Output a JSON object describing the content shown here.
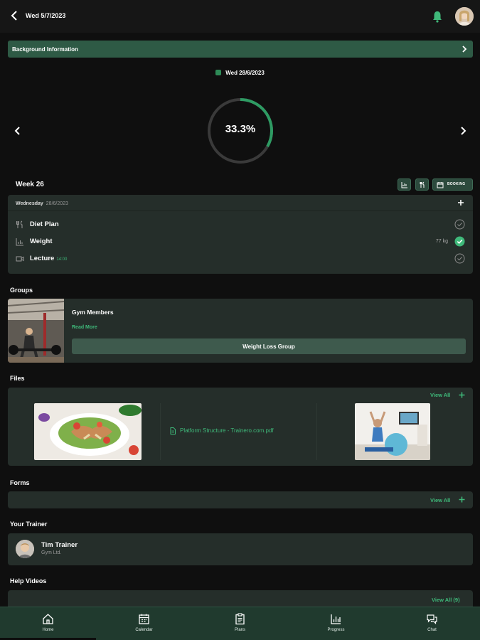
{
  "header": {
    "title": "Wed 5/7/2023",
    "icons": [
      "back-arrow-icon",
      "bell-icon",
      "avatar"
    ]
  },
  "background_info": {
    "label": "Background Information"
  },
  "progress": {
    "date": "Wed 28/6/2023",
    "percent_label": "33.3%",
    "fraction": 0.333
  },
  "week": {
    "title": "Week 26",
    "booking_label": "BOOKING"
  },
  "day_card": {
    "day": "Wednesday",
    "date": "28/6/2023",
    "tasks": [
      {
        "name": "Diet Plan",
        "sub": "",
        "value": "",
        "done": false,
        "icon": "utensils-icon"
      },
      {
        "name": "Weight",
        "sub": "",
        "value": "77 kg",
        "done": true,
        "icon": "chart-icon"
      },
      {
        "name": "Lecture",
        "sub": "14:00",
        "value": "",
        "done": false,
        "icon": "video-icon"
      }
    ]
  },
  "groups": {
    "title": "Groups",
    "item": {
      "name": "Gym Members",
      "read_more": "Read More",
      "button": "Weight Loss Group"
    }
  },
  "files": {
    "title": "Files",
    "view_all": "View All",
    "pdf_name": "Platform Structure - Trainero.com.pdf"
  },
  "forms": {
    "title": "Forms",
    "view_all": "View All"
  },
  "trainer": {
    "title": "Your Trainer",
    "name": "Tim Trainer",
    "org": "Gym Ltd."
  },
  "help_videos": {
    "title": "Help Videos",
    "view_all": "View All (9)"
  },
  "bottom_nav": [
    {
      "label": "Home",
      "icon": "home-icon"
    },
    {
      "label": "Calendar",
      "icon": "calendar-icon"
    },
    {
      "label": "Plans",
      "icon": "clipboard-icon"
    },
    {
      "label": "Progress",
      "icon": "chart-icon"
    },
    {
      "label": "Chat",
      "icon": "chat-icon"
    }
  ],
  "colors": {
    "accent": "#3fb97a",
    "card": "#252e2a",
    "banner": "#2e5a45",
    "nav": "#203a2e"
  }
}
